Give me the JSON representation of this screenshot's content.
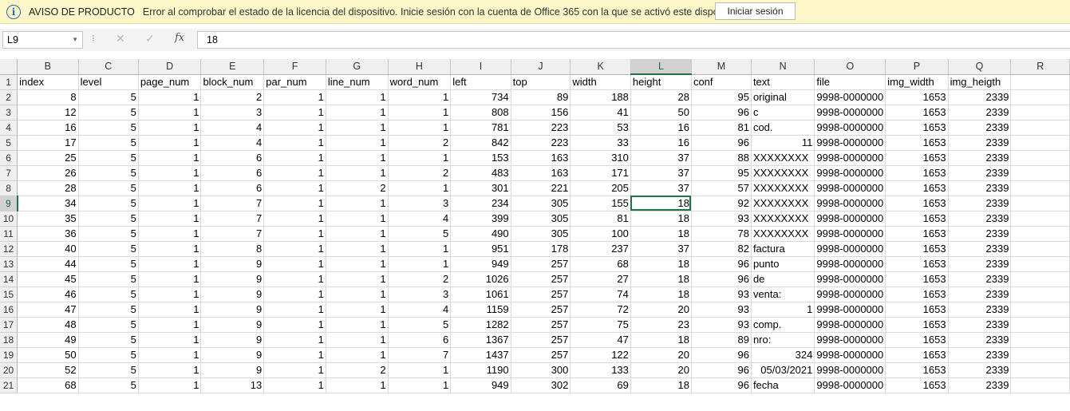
{
  "notice": {
    "title": "AVISO DE PRODUCTO",
    "message": "Error al comprobar el estado de la licencia del dispositivo. Inicie sesión con la cuenta de Office 365 con la que se activó este dispositivo.",
    "button_label": "Iniciar sesión"
  },
  "formula_bar": {
    "name_box": "L9",
    "cancel_icon": "✕",
    "enter_icon": "✓",
    "fx_label": "fx",
    "content": "18"
  },
  "sheet": {
    "columns": [
      "B",
      "C",
      "D",
      "E",
      "F",
      "G",
      "H",
      "I",
      "J",
      "K",
      "L",
      "M",
      "N",
      "O",
      "P",
      "Q",
      "R"
    ],
    "selected_column": "L",
    "selected_row": "9",
    "header_row": [
      "index",
      "level",
      "page_num",
      "block_num",
      "par_num",
      "line_num",
      "word_num",
      "left",
      "top",
      "width",
      "height",
      "conf",
      "text",
      "file",
      "img_width",
      "img_heigth",
      ""
    ],
    "rows": [
      {
        "num": "2",
        "cells": [
          "8",
          "5",
          "1",
          "2",
          "1",
          "1",
          "1",
          "734",
          "89",
          "188",
          "28",
          "95",
          "original",
          "9998-0000000",
          "1653",
          "2339",
          ""
        ]
      },
      {
        "num": "3",
        "cells": [
          "12",
          "5",
          "1",
          "3",
          "1",
          "1",
          "1",
          "808",
          "156",
          "41",
          "50",
          "96",
          "c",
          "9998-0000000",
          "1653",
          "2339",
          ""
        ]
      },
      {
        "num": "4",
        "cells": [
          "16",
          "5",
          "1",
          "4",
          "1",
          "1",
          "1",
          "781",
          "223",
          "53",
          "16",
          "81",
          "cod.",
          "9998-0000000",
          "1653",
          "2339",
          ""
        ]
      },
      {
        "num": "5",
        "cells": [
          "17",
          "5",
          "1",
          "4",
          "1",
          "1",
          "2",
          "842",
          "223",
          "33",
          "16",
          "96",
          "11",
          "9998-0000000",
          "1653",
          "2339",
          ""
        ]
      },
      {
        "num": "6",
        "cells": [
          "25",
          "5",
          "1",
          "6",
          "1",
          "1",
          "1",
          "153",
          "163",
          "310",
          "37",
          "88",
          "XXXXXXXX",
          "9998-0000000",
          "1653",
          "2339",
          ""
        ]
      },
      {
        "num": "7",
        "cells": [
          "26",
          "5",
          "1",
          "6",
          "1",
          "1",
          "2",
          "483",
          "163",
          "171",
          "37",
          "95",
          "XXXXXXXX",
          "9998-0000000",
          "1653",
          "2339",
          ""
        ]
      },
      {
        "num": "8",
        "cells": [
          "28",
          "5",
          "1",
          "6",
          "1",
          "2",
          "1",
          "301",
          "221",
          "205",
          "37",
          "57",
          "XXXXXXXX",
          "9998-0000000",
          "1653",
          "2339",
          ""
        ]
      },
      {
        "num": "9",
        "cells": [
          "34",
          "5",
          "1",
          "7",
          "1",
          "1",
          "3",
          "234",
          "305",
          "155",
          "18",
          "92",
          "XXXXXXXX",
          "9998-0000000",
          "1653",
          "2339",
          ""
        ]
      },
      {
        "num": "10",
        "cells": [
          "35",
          "5",
          "1",
          "7",
          "1",
          "1",
          "4",
          "399",
          "305",
          "81",
          "18",
          "93",
          "XXXXXXXX",
          "9998-0000000",
          "1653",
          "2339",
          ""
        ]
      },
      {
        "num": "11",
        "cells": [
          "36",
          "5",
          "1",
          "7",
          "1",
          "1",
          "5",
          "490",
          "305",
          "100",
          "18",
          "78",
          "XXXXXXXX",
          "9998-0000000",
          "1653",
          "2339",
          ""
        ]
      },
      {
        "num": "12",
        "cells": [
          "40",
          "5",
          "1",
          "8",
          "1",
          "1",
          "1",
          "951",
          "178",
          "237",
          "37",
          "82",
          "factura",
          "9998-0000000",
          "1653",
          "2339",
          ""
        ]
      },
      {
        "num": "13",
        "cells": [
          "44",
          "5",
          "1",
          "9",
          "1",
          "1",
          "1",
          "949",
          "257",
          "68",
          "18",
          "96",
          "punto",
          "9998-0000000",
          "1653",
          "2339",
          ""
        ]
      },
      {
        "num": "14",
        "cells": [
          "45",
          "5",
          "1",
          "9",
          "1",
          "1",
          "2",
          "1026",
          "257",
          "27",
          "18",
          "96",
          "de",
          "9998-0000000",
          "1653",
          "2339",
          ""
        ]
      },
      {
        "num": "15",
        "cells": [
          "46",
          "5",
          "1",
          "9",
          "1",
          "1",
          "3",
          "1061",
          "257",
          "74",
          "18",
          "93",
          "venta:",
          "9998-0000000",
          "1653",
          "2339",
          ""
        ]
      },
      {
        "num": "16",
        "cells": [
          "47",
          "5",
          "1",
          "9",
          "1",
          "1",
          "4",
          "1159",
          "257",
          "72",
          "20",
          "93",
          "1",
          "9998-0000000",
          "1653",
          "2339",
          ""
        ]
      },
      {
        "num": "17",
        "cells": [
          "48",
          "5",
          "1",
          "9",
          "1",
          "1",
          "5",
          "1282",
          "257",
          "75",
          "23",
          "93",
          "comp.",
          "9998-0000000",
          "1653",
          "2339",
          ""
        ]
      },
      {
        "num": "18",
        "cells": [
          "49",
          "5",
          "1",
          "9",
          "1",
          "1",
          "6",
          "1367",
          "257",
          "47",
          "18",
          "89",
          "nro:",
          "9998-0000000",
          "1653",
          "2339",
          ""
        ]
      },
      {
        "num": "19",
        "cells": [
          "50",
          "5",
          "1",
          "9",
          "1",
          "1",
          "7",
          "1437",
          "257",
          "122",
          "20",
          "96",
          "324",
          "9998-0000000",
          "1653",
          "2339",
          ""
        ]
      },
      {
        "num": "20",
        "cells": [
          "52",
          "5",
          "1",
          "9",
          "1",
          "2",
          "1",
          "1190",
          "300",
          "133",
          "20",
          "96",
          "05/03/2021",
          "9998-0000000",
          "1653",
          "2339",
          ""
        ]
      },
      {
        "num": "21",
        "cells": [
          "68",
          "5",
          "1",
          "13",
          "1",
          "1",
          "1",
          "949",
          "302",
          "69",
          "18",
          "96",
          "fecha",
          "9998-0000000",
          "1653",
          "2339",
          ""
        ]
      }
    ]
  }
}
